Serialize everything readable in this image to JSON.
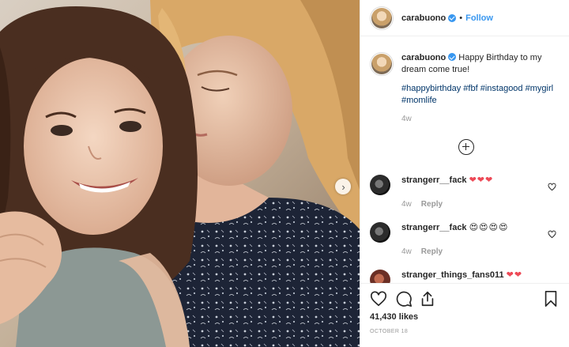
{
  "post": {
    "username": "carabuono",
    "follow_label": "Follow",
    "separator": "•"
  },
  "caption": {
    "username": "carabuono",
    "text": "Happy Birthday to my dream come true!",
    "hashtags": [
      "#happybirthday",
      "#fbf",
      "#instagood",
      "#mygirl",
      "#momlife"
    ],
    "time": "4w"
  },
  "comments": [
    {
      "username": "strangerr__fack",
      "emoji": "❤❤❤",
      "time": "4w",
      "reply_label": "Reply"
    },
    {
      "username": "strangerr__fack",
      "emoji": "😍😍😍😍",
      "time": "4w",
      "reply_label": "Reply"
    },
    {
      "username": "stranger_things_fans011",
      "emoji": "❤❤"
    }
  ],
  "footer": {
    "likes": "41,430 likes",
    "date": "OCTOBER 18"
  },
  "colors": {
    "link": "#3897f0",
    "hashtag": "#003569",
    "heart": "#ed4956",
    "muted": "#999999"
  },
  "icons": [
    "verified-icon",
    "next-arrow-icon",
    "add-comment-icon",
    "heart-icon",
    "comment-icon",
    "share-icon",
    "bookmark-icon"
  ]
}
